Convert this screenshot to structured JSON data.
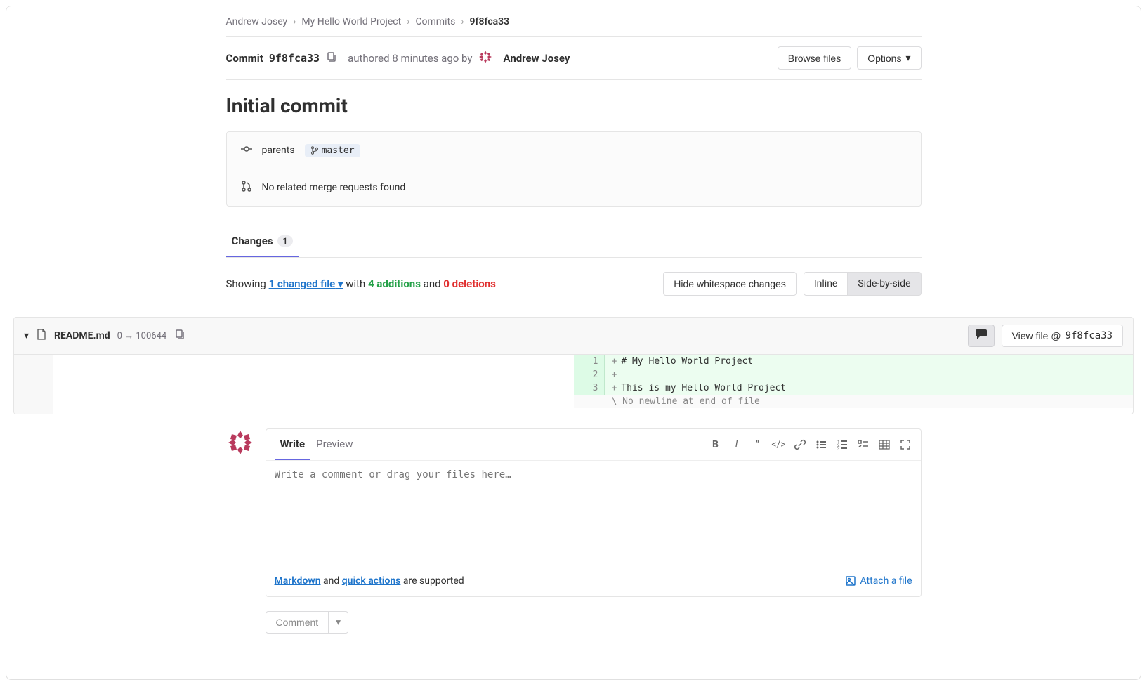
{
  "breadcrumb": {
    "items": [
      "Andrew Josey",
      "My Hello World Project",
      "Commits"
    ],
    "current": "9f8fca33"
  },
  "header": {
    "commit_label": "Commit",
    "sha": "9f8fca33",
    "authored_prefix": "authored",
    "time": "8 minutes ago",
    "by": "by",
    "author": "Andrew Josey",
    "browse_files": "Browse files",
    "options": "Options"
  },
  "title": "Initial commit",
  "info": {
    "parents_label": "parents",
    "branch": "master",
    "no_mr": "No related merge requests found"
  },
  "tabs": {
    "changes": "Changes",
    "count": "1"
  },
  "summary": {
    "showing": "Showing",
    "changed_file": "1 changed file",
    "with": "with",
    "additions": "4 additions",
    "and": "and",
    "deletions": "0 deletions",
    "hide_ws": "Hide whitespace changes",
    "inline": "Inline",
    "side_by_side": "Side-by-side"
  },
  "diff": {
    "filename": "README.md",
    "meta_from": "0",
    "meta_arrow": "→",
    "meta_to": "100644",
    "view_file_prefix": "View file @",
    "view_file_sha": "9f8fca33",
    "lines": [
      {
        "n": "1",
        "text": "# My Hello World Project"
      },
      {
        "n": "2",
        "text": ""
      },
      {
        "n": "3",
        "text": "This is my Hello World Project"
      }
    ],
    "no_newline": "\\ No newline at end of file"
  },
  "comment": {
    "write_tab": "Write",
    "preview_tab": "Preview",
    "placeholder": "Write a comment or drag your files here…",
    "markdown": "Markdown",
    "and": "and",
    "quick_actions": "quick actions",
    "supported": "are supported",
    "attach": "Attach a file",
    "comment_btn": "Comment"
  }
}
